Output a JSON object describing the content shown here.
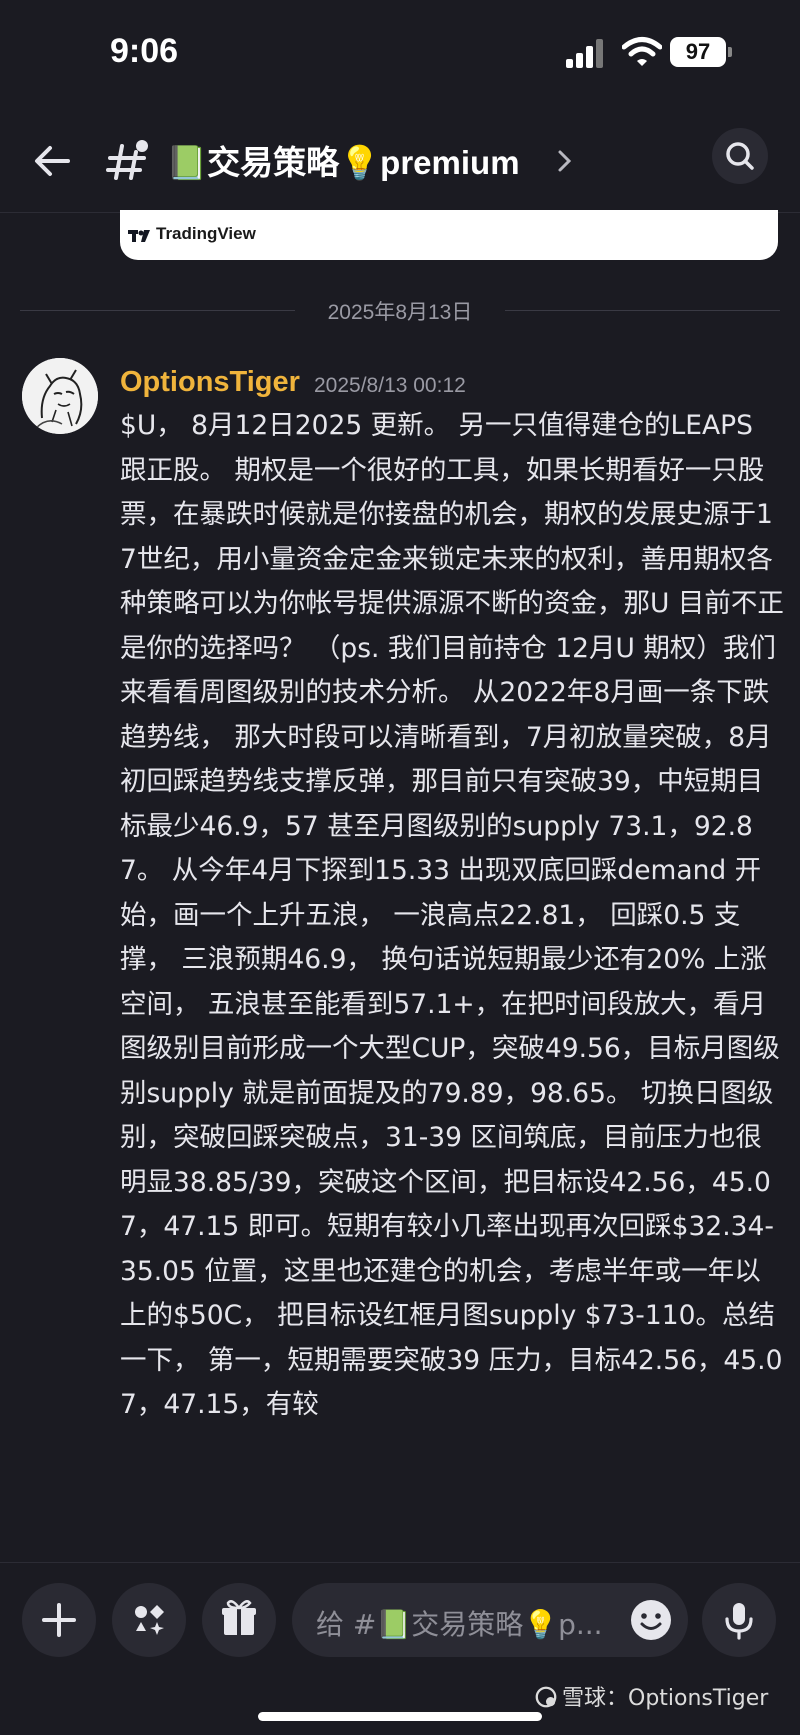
{
  "status_bar": {
    "time": "9:06",
    "battery": "97"
  },
  "header": {
    "channel_title": "📗交易策略💡premium"
  },
  "embed": {
    "provider": "TradingView"
  },
  "date_divider": "2025年8月13日",
  "message": {
    "author": "OptionsTiger",
    "timestamp": "2025/8/13 00:12",
    "body": "$U， 8月12日2025 更新。 另一只值得建仓的LEAPS 跟正股。 期权是一个很好的工具，如果长期看好一只股票，在暴跌时候就是你接盘的机会，期权的发展史源于17世纪，用小量资金定金来锁定未来的权利，善用期权各种策略可以为你帐号提供源源不断的资金，那U 目前不正是你的选择吗？ （ps. 我们目前持仓 12月U 期权）我们来看看周图级别的技术分析。 从2022年8月画一条下跌趋势线， 那大时段可以清晰看到，7月初放量突破，8月初回踩趋势线支撑反弹，那目前只有突破39，中短期目标最少46.9，57 甚至月图级别的supply 73.1，92.87。 从今年4月下探到15.33 出现双底回踩demand 开始，画一个上升五浪， 一浪高点22.81， 回踩0.5 支撑， 三浪预期46.9， 换句话说短期最少还有20% 上涨空间， 五浪甚至能看到57.1+，在把时间段放大，看月图级别目前形成一个大型CUP，突破49.56，目标月图级别supply 就是前面提及的79.89，98.65。 切换日图级别，突破回踩突破点，31-39 区间筑底，目前压力也很明显38.85/39，突破这个区间，把目标设42.56，45.07，47.15 即可。短期有较小几率出现再次回踩$32.34-35.05 位置，这里也还建仓的机会，考虑半年或一年以上的$50C， 把目标设红框月图supply $73-110。总结一下， 第一，短期需要突破39 压力，目标42.56，45.07，47.15，有较"
  },
  "composer": {
    "placeholder": "给 #📗交易策略💡p..."
  },
  "watermark": "雪球：OptionsTiger",
  "icons": [
    "back-arrow-icon",
    "hash-icon",
    "chevron-right-icon",
    "search-icon",
    "plus-icon",
    "apps-icon",
    "gift-icon",
    "emoji-icon",
    "microphone-icon",
    "tradingview-logo-icon",
    "snowball-logo-icon"
  ]
}
